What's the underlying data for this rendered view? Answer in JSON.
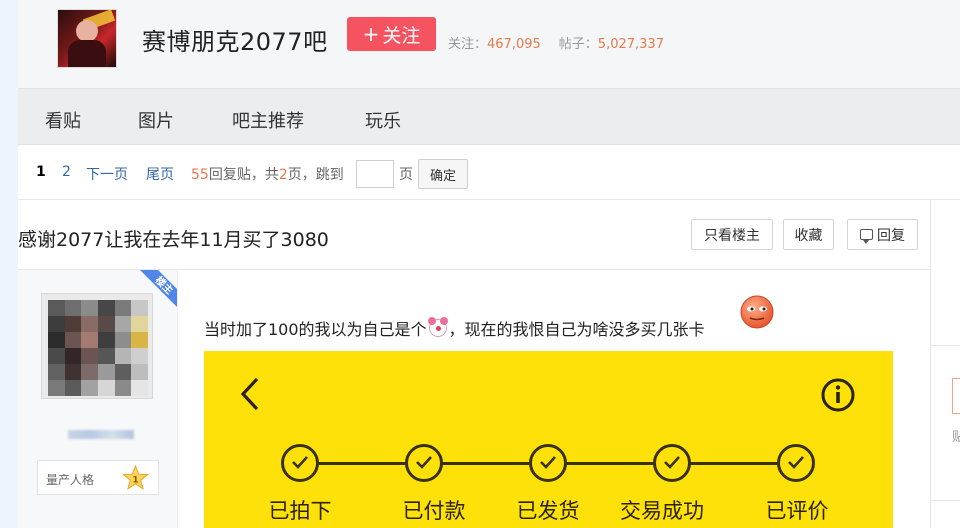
{
  "forum": {
    "name": "赛博朋克2077吧",
    "follow_label": "关注",
    "followers_label": "关注：",
    "followers_value": "467,095",
    "posts_label": "帖子：",
    "posts_value": "5,027,337"
  },
  "nav": {
    "items": [
      {
        "label": "看贴"
      },
      {
        "label": "图片"
      },
      {
        "label": "吧主推荐"
      },
      {
        "label": "玩乐"
      }
    ]
  },
  "pager": {
    "page1": "1",
    "page2": "2",
    "next": "下一页",
    "last": "尾页",
    "reply_count": "55",
    "reply_text": "回复贴，共",
    "total_pages": "2",
    "pages_text": "页，跳到",
    "page_unit": "页",
    "confirm": "确定"
  },
  "thread": {
    "title": "感谢2077让我在去年11月买了3080",
    "only_op": "只看楼主",
    "favorite": "收藏",
    "reply": "回复"
  },
  "author": {
    "badge": "楼主",
    "level_label": "量产人格",
    "level_num": "1"
  },
  "post": {
    "text_before": "当时加了100的我以为自己是个",
    "text_after": "，现在的我恨自己为啥没多买几张卡"
  },
  "order_steps": [
    {
      "label": "已拍下"
    },
    {
      "label": "已付款"
    },
    {
      "label": "已发货"
    },
    {
      "label": "交易成功"
    },
    {
      "label": "已评价"
    }
  ],
  "right_col": {
    "text": "贴"
  },
  "colors": {
    "follow_button": "#f5535f",
    "stat_number": "#e67a4b",
    "link": "#3466a6",
    "op_badge": "#4f86e8",
    "screenshot_bg": "#ffe10a"
  },
  "icons": [
    "back-arrow-icon",
    "info-icon",
    "check-icon",
    "clown-emoji-icon",
    "face-emoji-icon",
    "reply-icon",
    "star-level-icon"
  ]
}
